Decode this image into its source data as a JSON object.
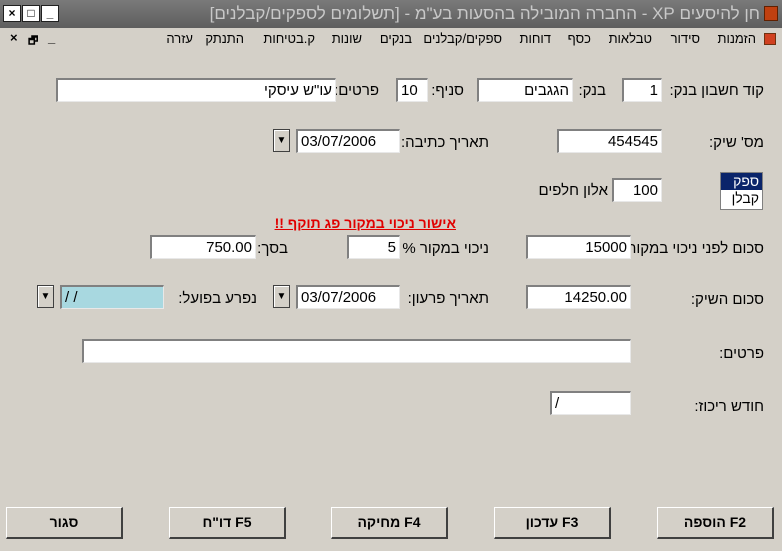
{
  "window": {
    "title": "חן להיסעים XP - החברה המובילה בהסעות בע\"מ - [תשלומים לספקים/קבלנים]",
    "buttons": {
      "close": "×",
      "restore": "□",
      "minimize": "_"
    }
  },
  "menu": {
    "items": [
      "הזמנות",
      "סידור",
      "טבלאות",
      "כסף",
      "דוחות",
      "ספקים/קבלנים",
      "בנקים",
      "שונות",
      "ק.בטיחות",
      "התנתק",
      "עזרה"
    ],
    "mdi_controls": {
      "close": "×",
      "restore": "🗗",
      "minimize": "_"
    }
  },
  "form": {
    "bank_code": {
      "label": "קוד חשבון בנק:",
      "value": "1"
    },
    "bank": {
      "label": "בנק:",
      "value": "הגגבים"
    },
    "branch": {
      "label": "סניף:",
      "value": "10"
    },
    "details_top": {
      "label": "פרטים:",
      "value": "עו\"ש עיסקי"
    },
    "check_number": {
      "label": "מס' שיק:",
      "value": "454545"
    },
    "write_date": {
      "label": "תאריך כתיבה:",
      "value": "03/07/2006"
    },
    "type_list": {
      "options": [
        "ספק",
        "קבלן"
      ],
      "selected": "ספק"
    },
    "book_number": {
      "label": "אלון חלפים",
      "value": "100"
    },
    "warning": "אישור ניכוי במקור פג תוקף !!",
    "amount_before": {
      "label": "סכום לפני ניכוי במקור:",
      "value": "15000"
    },
    "withholding_pct": {
      "label": "ניכוי במקור %",
      "value": "5"
    },
    "total": {
      "label": "בסך:",
      "value": "750.00"
    },
    "check_amount": {
      "label": "סכום השיק:",
      "value": "14250.00"
    },
    "redeem_date": {
      "label": "תאריך פרעון:",
      "value": "03/07/2006"
    },
    "actually_paid": {
      "label": "נפרע בפועל:",
      "value": "/  /"
    },
    "details": {
      "label": "פרטים:",
      "value": ""
    },
    "consolidation_month": {
      "label": "חודש ריכוז:",
      "value": "/"
    }
  },
  "buttons": {
    "add": "הוספה F2",
    "update": "עדכון F3",
    "delete": "מחיקה F4",
    "report": "דו\"ח F5",
    "close": "סגור"
  },
  "colors": {
    "window_bg": "#d4d0c8",
    "warning": "#e00000",
    "date_field_highlight": "#a8d8e0",
    "selection": "#0a246a"
  },
  "icons": {
    "dropdown": "▼"
  }
}
